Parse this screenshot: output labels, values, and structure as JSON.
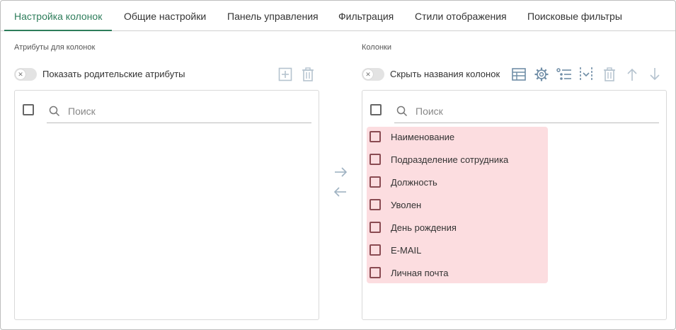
{
  "tabs": [
    {
      "label": "Настройка колонок",
      "active": true
    },
    {
      "label": "Общие настройки",
      "active": false
    },
    {
      "label": "Панель управления",
      "active": false
    },
    {
      "label": "Фильтрация",
      "active": false
    },
    {
      "label": "Стили отображения",
      "active": false
    },
    {
      "label": "Поисковые фильтры",
      "active": false
    }
  ],
  "left": {
    "section_label": "Атрибуты для колонок",
    "toggle_label": "Показать родительские атрибуты",
    "search_placeholder": "Поиск"
  },
  "right": {
    "section_label": "Колонки",
    "toggle_label": "Скрыть названия колонок",
    "search_placeholder": "Поиск",
    "columns": [
      "Наименование",
      "Подразделение сотрудника",
      "Должность",
      "Уволен",
      "День рождения",
      "E-MAIL",
      "Личная почта"
    ]
  },
  "colors": {
    "accent": "#2e7d5b",
    "icon": "#6f8da6",
    "icon_disabled": "#b5c3cf",
    "list_highlight": "#fcdde0"
  }
}
